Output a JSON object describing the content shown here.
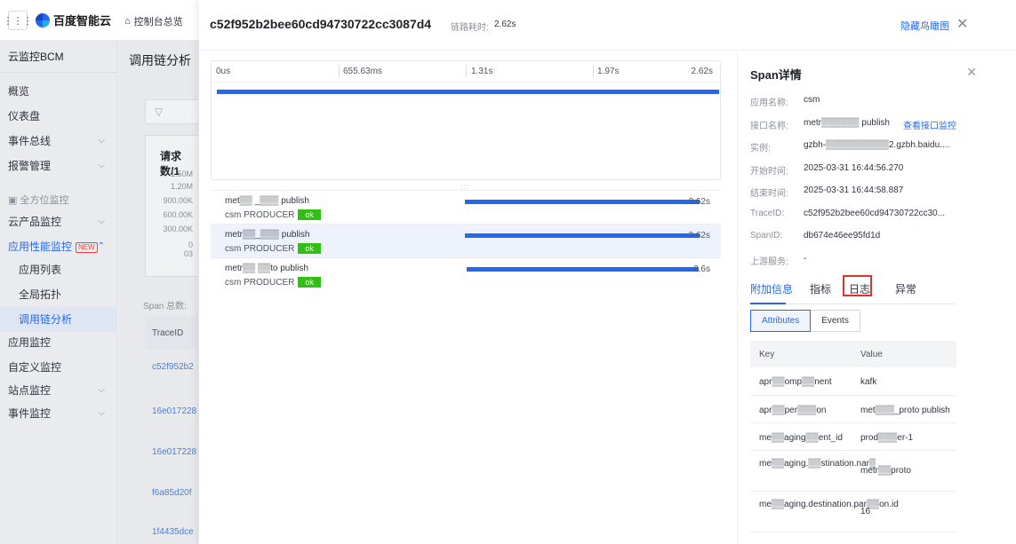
{
  "topbar": {
    "logo_text": "百度智能云",
    "home_label": "控制台总览"
  },
  "nav": {
    "title": "云监控BCM",
    "items": [
      {
        "label": "概览",
        "top": 43
      },
      {
        "label": "仪表盘",
        "top": 71
      },
      {
        "label": "事件总线",
        "top": 99,
        "arrow": "⌵"
      },
      {
        "label": "报警管理",
        "top": 127,
        "arrow": "⌵"
      }
    ],
    "section_label": "全方位监控",
    "cloud_label": "云产品监控",
    "apm_label": "应用性能监控",
    "new_badge": "NEW",
    "apm_sub": [
      "应用列表",
      "全局拓扑",
      "调用链分析"
    ],
    "bottom_items": [
      "应用监控",
      "自定义监控",
      "站点监控",
      "事件监控"
    ]
  },
  "background": {
    "page_title": "调用链分析",
    "card_title": "请求数/1",
    "y_ticks": [
      "1.50M",
      "1.20M",
      "900.00K",
      "600.00K",
      "300.00K",
      "0",
      "03"
    ],
    "span_total": "Span 总数:",
    "trace_header": "TraceID",
    "trace_ids": [
      "c52f952b2",
      "16e017228",
      "16e017228",
      "f6a85d20f",
      "1f4435dce"
    ]
  },
  "drawer": {
    "trace_id": "c52f952b2bee60cd94730722cc3087d4",
    "latency_label": "链路耗时:",
    "latency_value": "2.62s",
    "hide_label": "隐藏鸟瞰图",
    "timeline_ticks": [
      "0us",
      "655.63ms",
      "1.31s",
      "1.97s",
      "2.62s"
    ],
    "spans": [
      {
        "name": "met▒▒ _▒▒▒ publish",
        "service": "csm",
        "kind": "PRODUCER",
        "status": "ok",
        "duration": "2.62s",
        "bar_start": 0.0,
        "bar_width": 1.0
      },
      {
        "name": "metr▒▒_▒▒▒ publish",
        "service": "csm",
        "kind": "PRODUCER",
        "status": "ok",
        "duration": "2.62s",
        "bar_start": 0.0,
        "bar_width": 1.0
      },
      {
        "name": "metr▒▒ ▒▒to publish",
        "service": "csm",
        "kind": "PRODUCER",
        "status": "ok",
        "duration": "2.6s",
        "bar_start": 0.008,
        "bar_width": 0.99
      }
    ]
  },
  "detail": {
    "title": "Span详情",
    "fields": [
      {
        "key": "应用名称:",
        "value": "csm"
      },
      {
        "key": "接口名称:",
        "value": "metr▒▒▒▒▒▒ publish",
        "link": "查看接口监控"
      },
      {
        "key": "实例:",
        "value": "gzbh-▒▒▒▒▒▒▒▒▒▒2.gzbh.baidu...."
      },
      {
        "key": "开始时间:",
        "value": "2025-03-31 16:44:56.270"
      },
      {
        "key": "结束时间:",
        "value": "2025-03-31 16:44:58.887"
      },
      {
        "key": "TraceID:",
        "value": "c52f952b2bee60cd94730722cc30..."
      },
      {
        "key": "SpanID:",
        "value": "db674e46ee95fd1d"
      },
      {
        "key": "上游服务:",
        "value": "-"
      }
    ],
    "tabs": [
      "附加信息",
      "指标",
      "日志",
      "异常"
    ],
    "seg": [
      "Attributes",
      "Events"
    ],
    "table_head": {
      "key": "Key",
      "value": "Value"
    },
    "rows": [
      {
        "key": "apr▒▒omp▒▒nent",
        "value": "kafk",
        "h": 32
      },
      {
        "key": "apr▒▒per▒▒▒on",
        "value": "met▒▒▒_proto publish",
        "h": 31
      },
      {
        "key": "me▒▒aging▒▒ent_id",
        "value": "prod▒▒▒er-1",
        "h": 31
      },
      {
        "key": "me▒▒aging.▒▒stination.nar▒",
        "value": "metr▒▒proto",
        "h": 46
      },
      {
        "key": "me▒▒aging.destination.par▒▒on.id",
        "value": "16",
        "h": 46
      }
    ]
  }
}
